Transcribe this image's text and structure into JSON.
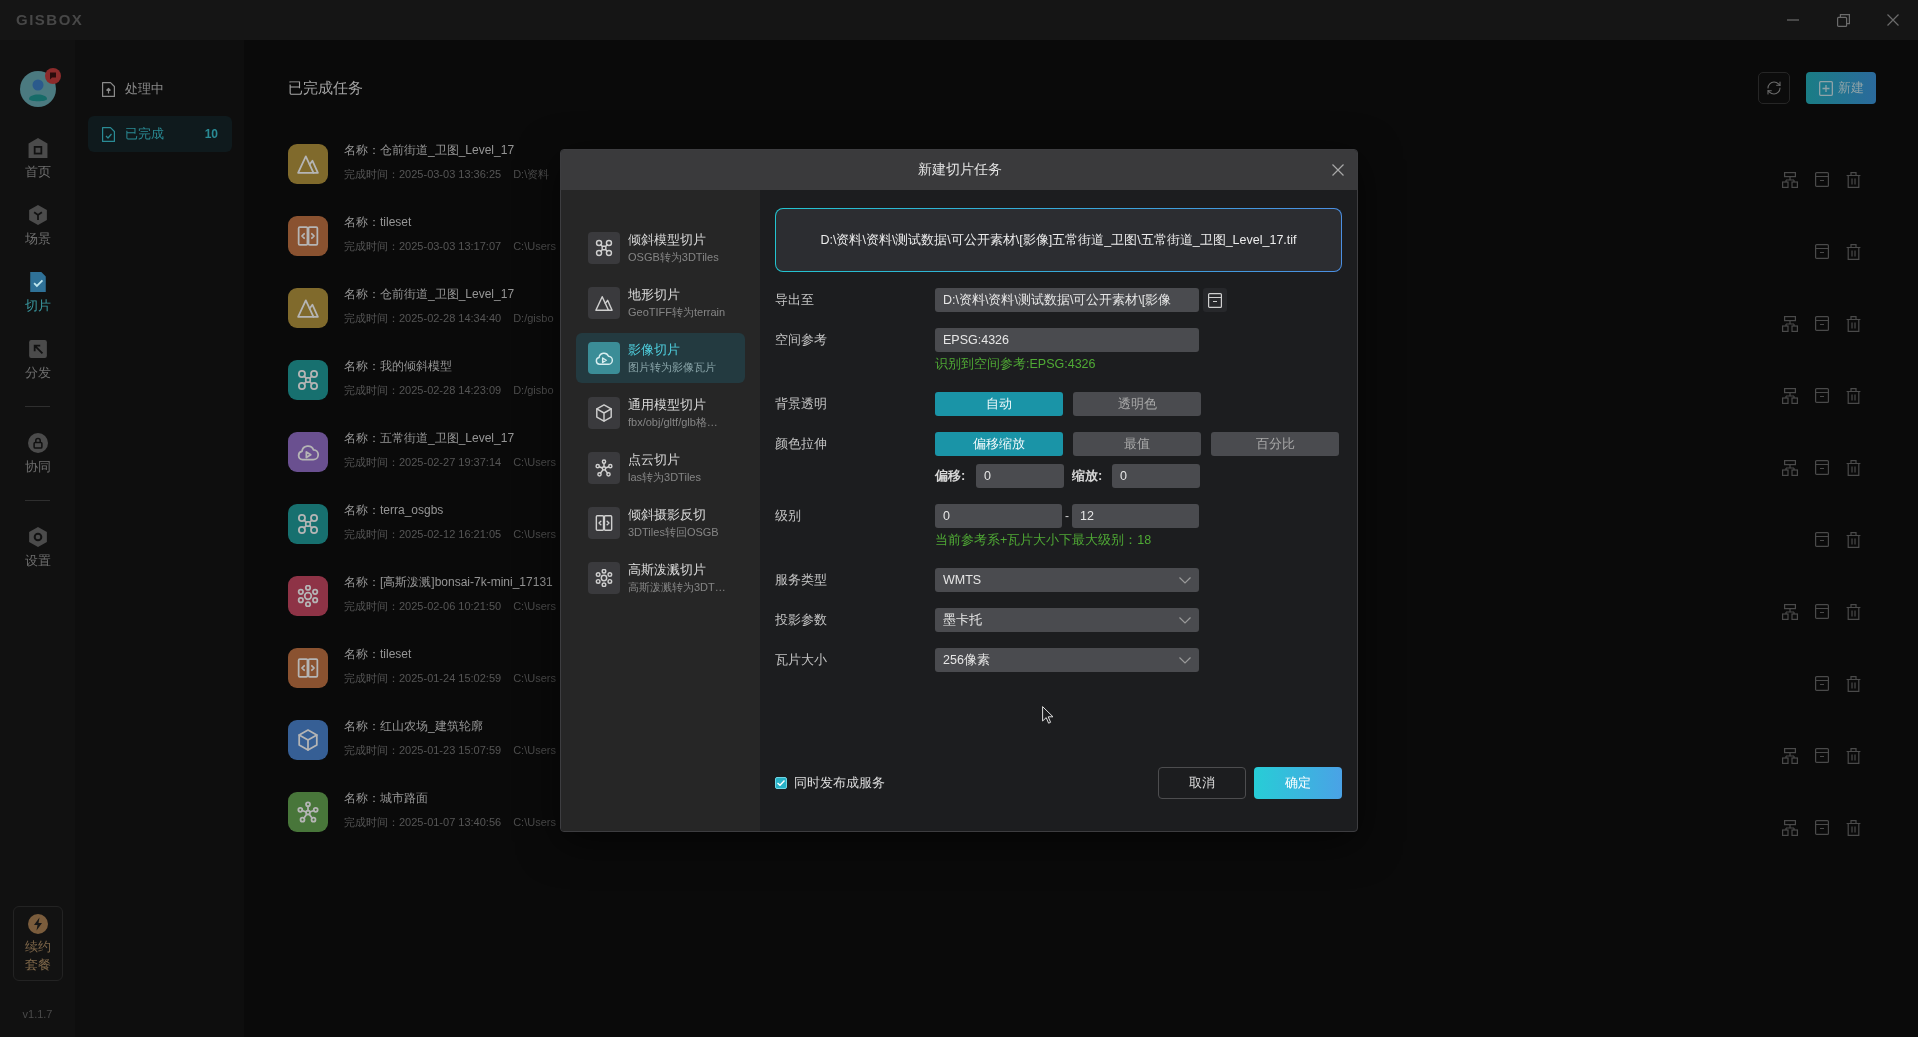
{
  "app": {
    "logo": "GISBOX",
    "renew": "续约套餐",
    "version": "v1.1.7"
  },
  "nav_groups": [
    [
      {
        "kind": "home",
        "label": "首页",
        "selected": false
      },
      {
        "kind": "scene",
        "label": "场景",
        "selected": false
      },
      {
        "kind": "slice",
        "label": "切片",
        "selected": true
      },
      {
        "kind": "distribute",
        "label": "分发",
        "selected": false
      }
    ],
    [
      {
        "kind": "collab",
        "label": "协同",
        "selected": false
      }
    ],
    [
      {
        "kind": "settings",
        "label": "设置",
        "selected": false
      }
    ]
  ],
  "sub_menu": [
    {
      "kind": "processing",
      "label": "处理中",
      "selected": false
    },
    {
      "kind": "done",
      "label": "已完成",
      "count": "10",
      "selected": true
    }
  ],
  "main": {
    "title": "已完成任务",
    "new_button": "新建",
    "tasks": [
      {
        "kind": "terrain",
        "color": "#806a2c",
        "name": "名称：仓前街道_卫图_Level_17",
        "time": "完成时间：2025-03-03 13:36:25",
        "path": "D:\\资料",
        "hierarchy_action": true
      },
      {
        "kind": "reverse",
        "color": "#8a5230",
        "name": "名称：tileset",
        "time": "完成时间：2025-03-03 13:17:07",
        "path": "C:\\Users",
        "hierarchy_action": false
      },
      {
        "kind": "terrain",
        "color": "#806a2c",
        "name": "名称：仓前街道_卫图_Level_17",
        "time": "完成时间：2025-02-28 14:34:40",
        "path": "D:/gisbo",
        "hierarchy_action": true
      },
      {
        "kind": "oblique",
        "color": "#17706f",
        "name": "名称：我的倾斜模型",
        "time": "完成时间：2025-02-28 14:23:09",
        "path": "D:/gisbo",
        "hierarchy_action": true
      },
      {
        "kind": "imagery",
        "color": "#6a5090",
        "name": "名称：五常街道_卫图_Level_17",
        "time": "完成时间：2025-02-27 19:37:14",
        "path": "C:\\Users",
        "hierarchy_action": true
      },
      {
        "kind": "oblique",
        "color": "#17706f",
        "name": "名称：terra_osgbs",
        "time": "完成时间：2025-02-12 16:21:05",
        "path": "C:\\Users",
        "hierarchy_action": false
      },
      {
        "kind": "gaussian",
        "color": "#8e3346",
        "name": "名称：[高斯泼溅]bonsai-7k-mini_17131",
        "time": "完成时间：2025-02-06 10:21:50",
        "path": "C:\\Users",
        "hierarchy_action": true
      },
      {
        "kind": "reverse",
        "color": "#8a5230",
        "name": "名称：tileset",
        "time": "完成时间：2025-01-24 15:02:59",
        "path": "C:\\Users",
        "hierarchy_action": false
      },
      {
        "kind": "model",
        "color": "#365f95",
        "name": "名称：红山农场_建筑轮廓",
        "time": "完成时间：2025-01-23 15:07:59",
        "path": "C:\\Users",
        "hierarchy_action": true
      },
      {
        "kind": "pointcloud",
        "color": "#48763a",
        "name": "名称：城市路面",
        "time": "完成时间：2025-01-07 13:40:56",
        "path": "C:\\Users",
        "hierarchy_action": true
      }
    ]
  },
  "dialog": {
    "title": "新建切片任务",
    "task_types": [
      {
        "kind": "oblique",
        "title": "倾斜模型切片",
        "subtitle": "OSGB转为3DTiles",
        "selected": false
      },
      {
        "kind": "terrain",
        "title": "地形切片",
        "subtitle": "GeoTIFF转为terrain",
        "selected": false
      },
      {
        "kind": "imagery",
        "title": "影像切片",
        "subtitle": "图片转为影像瓦片",
        "selected": true
      },
      {
        "kind": "model",
        "title": "通用模型切片",
        "subtitle": "fbx/obj/gltf/glb格…",
        "selected": false
      },
      {
        "kind": "pointcloud",
        "title": "点云切片",
        "subtitle": "las转为3DTiles",
        "selected": false
      },
      {
        "kind": "reverse",
        "title": "倾斜摄影反切",
        "subtitle": "3DTiles转回OSGB",
        "selected": false
      },
      {
        "kind": "gaussian",
        "title": "高斯泼溅切片",
        "subtitle": "高斯泼溅转为3DT…",
        "selected": false
      }
    ],
    "source_file": "D:\\资料\\资料\\测试数据\\可公开素材\\[影像]五常街道_卫图\\五常街道_卫图_Level_17.tif",
    "export": {
      "label": "导出至",
      "value": "D:\\资料\\资料\\测试数据\\可公开素材\\[影像"
    },
    "spatial_ref": {
      "label": "空间参考",
      "value": "EPSG:4326",
      "hint": "识别到空间参考:EPSG:4326"
    },
    "background": {
      "label": "背景透明",
      "options": [
        {
          "label": "自动",
          "selected": true
        },
        {
          "label": "透明色",
          "selected": false
        }
      ]
    },
    "stretch": {
      "label": "颜色拉伸",
      "options": [
        {
          "label": "偏移缩放",
          "selected": true
        },
        {
          "label": "最值",
          "selected": false
        },
        {
          "label": "百分比",
          "selected": false
        }
      ],
      "params": [
        {
          "label": "偏移:",
          "value": "0"
        },
        {
          "label": "缩放:",
          "value": "0"
        }
      ]
    },
    "level": {
      "label": "级别",
      "min": "0",
      "separator": "-",
      "max": "12",
      "hint": "当前参考系+瓦片大小下最大级别：18"
    },
    "selects": [
      {
        "label": "服务类型",
        "value": "WMTS"
      },
      {
        "label": "投影参数",
        "value": "墨卡托"
      },
      {
        "label": "瓦片大小",
        "value": "256像素"
      }
    ],
    "publish": {
      "label": "同时发布成服务",
      "checked": true
    },
    "buttons": [
      {
        "kind": "secondary",
        "label": "取消"
      },
      {
        "kind": "primary",
        "label": "确定"
      }
    ]
  }
}
